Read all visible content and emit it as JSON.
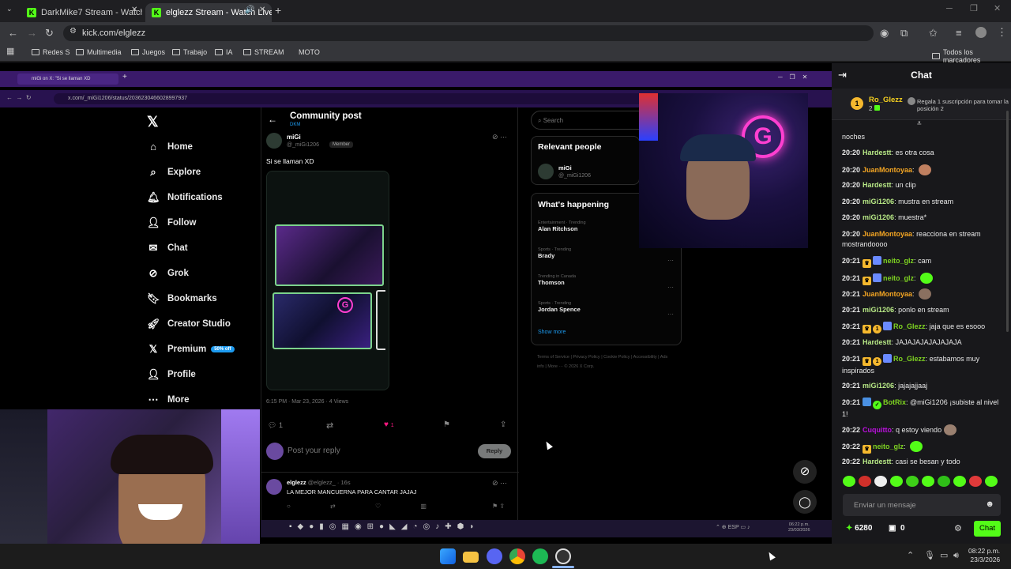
{
  "browser": {
    "tabs": [
      {
        "title": "DarkMike7 Stream - Watch Live"
      },
      {
        "title": "elglezz Stream - Watch Live"
      }
    ],
    "url": "kick.com/elglezz",
    "bookmarks": [
      "Redes S",
      "Multimedia",
      "Juegos",
      "Trabajo",
      "IA",
      "STREAM",
      "MOTO"
    ],
    "all_bookmarks": "Todos los marcadores"
  },
  "inner_browser": {
    "tab_title": "miGi on X: \"Si se llaman XD",
    "url": "x.com/_miGi1206/status/2036230466028997937"
  },
  "x_nav": [
    "Home",
    "Explore",
    "Notifications",
    "Follow",
    "Chat",
    "Grok",
    "Bookmarks",
    "Creator Studio",
    "Premium",
    "Profile",
    "More"
  ],
  "premium_badge": "50% off",
  "post": {
    "header": "Community post",
    "community": "DKM",
    "author": "miGi",
    "handle": "@_miGi1206",
    "role": "Member",
    "text": "Si se llaman XD",
    "meta": "6:15 PM · Mar 23, 2026 · 4 Views",
    "reply_count": "1",
    "like_count": "1",
    "reply_placeholder": "Post your reply",
    "reply_button": "Reply",
    "reply_author": "elglezz",
    "reply_handle": "@elglezz_ · 16s",
    "reply_text": "LA MEJOR MANCUERNA PARA CANTAR JAJAJ"
  },
  "x_right": {
    "search": "Search",
    "relevant": "Relevant people",
    "person": "miGi",
    "person_handle": "@_miGi1206",
    "happening": "What's happening",
    "trends": [
      {
        "cat": "Entertainment · Trending",
        "name": "Alan Ritchson"
      },
      {
        "cat": "Sports · Trending",
        "name": "Brady"
      },
      {
        "cat": "Trending in Canada",
        "name": "Thomson"
      },
      {
        "cat": "Sports · Trending",
        "name": "Jordan Spence"
      }
    ],
    "show_more": "Show more",
    "footer": "Terms of Service  |  Privacy Policy  |  Cookie Policy  |  Accessibility  |  Ads info  |  More ···  © 2026 X Corp."
  },
  "chat": {
    "title": "Chat",
    "top_user": "Ro_Glezz",
    "top_rank": "1",
    "top_count": "2",
    "gift_text": "Regala 1 suscripción para tomar la posición 2",
    "messages": [
      {
        "t": "",
        "u": "",
        "c": "#e8e8e8",
        "m": "noches"
      },
      {
        "t": "20:20",
        "u": "Hardestt",
        "c": "#b8e986",
        "m": "es otra cosa"
      },
      {
        "t": "20:20",
        "u": "JuanMontoyaa",
        "c": "#f5a623",
        "m": ""
      },
      {
        "t": "20:20",
        "u": "Hardestt",
        "c": "#b8e986",
        "m": "un clip"
      },
      {
        "t": "20:20",
        "u": "miGi1206",
        "c": "#b8e986",
        "m": "mustra en stream"
      },
      {
        "t": "20:20",
        "u": "miGi1206",
        "c": "#b8e986",
        "m": "muestra*"
      },
      {
        "t": "20:20",
        "u": "JuanMontoyaa",
        "c": "#f5a623",
        "m": "reacciona en stream mostrandoooo"
      },
      {
        "t": "20:21",
        "u": "neito_glz",
        "c": "#7ed321",
        "m": "cam"
      },
      {
        "t": "20:21",
        "u": "neito_glz",
        "c": "#7ed321",
        "m": ""
      },
      {
        "t": "20:21",
        "u": "JuanMontoyaa",
        "c": "#f5a623",
        "m": ""
      },
      {
        "t": "20:21",
        "u": "miGi1206",
        "c": "#b8e986",
        "m": "ponlo en stream"
      },
      {
        "t": "20:21",
        "u": "Ro_Glezz",
        "c": "#7ed321",
        "m": "jaja que es esooo"
      },
      {
        "t": "20:21",
        "u": "Hardestt",
        "c": "#b8e986",
        "m": "JAJAJAJAJAJAJAJA"
      },
      {
        "t": "20:21",
        "u": "Ro_Glezz",
        "c": "#7ed321",
        "m": "estabamos muy inspirados"
      },
      {
        "t": "20:21",
        "u": "miGi1206",
        "c": "#b8e986",
        "m": "jajajajjaaj"
      },
      {
        "t": "20:21",
        "u": "BotRix",
        "c": "#7ed321",
        "m": "@miGi1206 ¡subiste al nivel 1!"
      },
      {
        "t": "20:22",
        "u": "Cuquitto",
        "c": "#bd10e0",
        "m": "q estoy viendo"
      },
      {
        "t": "20:22",
        "u": "neito_glz",
        "c": "#7ed321",
        "m": ""
      },
      {
        "t": "20:22",
        "u": "Hardestt",
        "c": "#b8e986",
        "m": "casi se besan y todo"
      }
    ],
    "input_placeholder": "Enviar un mensaje",
    "points": "6280",
    "count": "0",
    "send": "Chat"
  },
  "system": {
    "time": "08:22 p.m.",
    "date": "23/3/2026",
    "inner_time": "06:22 p.m.",
    "inner_date": "23/03/2026",
    "inner_lang": "ESP"
  },
  "colors": {
    "kick_green": "#53fc18",
    "x_blue": "#1d9bf0",
    "purple": "#7b2cf5"
  }
}
